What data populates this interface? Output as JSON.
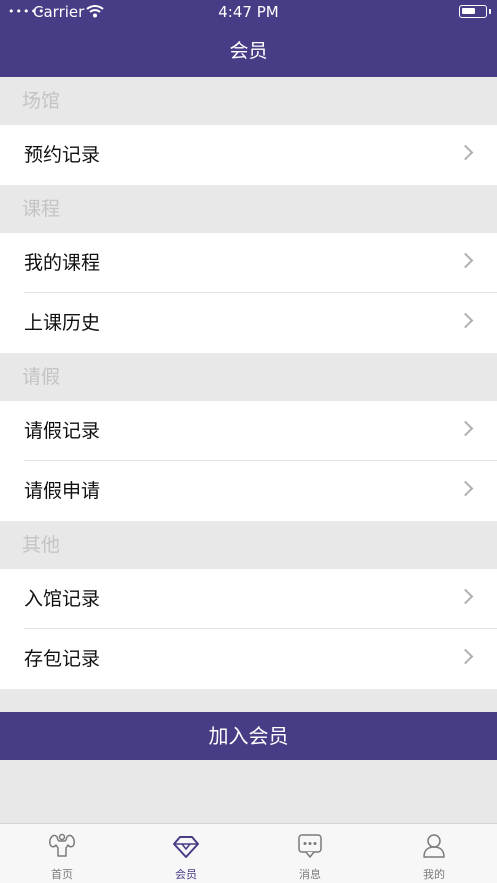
{
  "status_bar": {
    "carrier": "Carrier",
    "time": "4:47 PM"
  },
  "nav": {
    "title": "会员"
  },
  "sections": [
    {
      "header": "场馆",
      "rows": [
        "预约记录"
      ]
    },
    {
      "header": "课程",
      "rows": [
        "我的课程",
        "上课历史"
      ]
    },
    {
      "header": "请假",
      "rows": [
        "请假记录",
        "请假申请"
      ]
    },
    {
      "header": "其他",
      "rows": [
        "入馆记录",
        "存包记录"
      ]
    }
  ],
  "join_button": "加入会员",
  "tabbar": {
    "items": [
      {
        "label": "首页",
        "icon": "muscle-icon"
      },
      {
        "label": "会员",
        "icon": "diamond-icon",
        "active": true
      },
      {
        "label": "消息",
        "icon": "message-icon"
      },
      {
        "label": "我的",
        "icon": "person-icon"
      }
    ]
  },
  "colors": {
    "brand": "#473c86",
    "background": "#e8e8e8"
  }
}
